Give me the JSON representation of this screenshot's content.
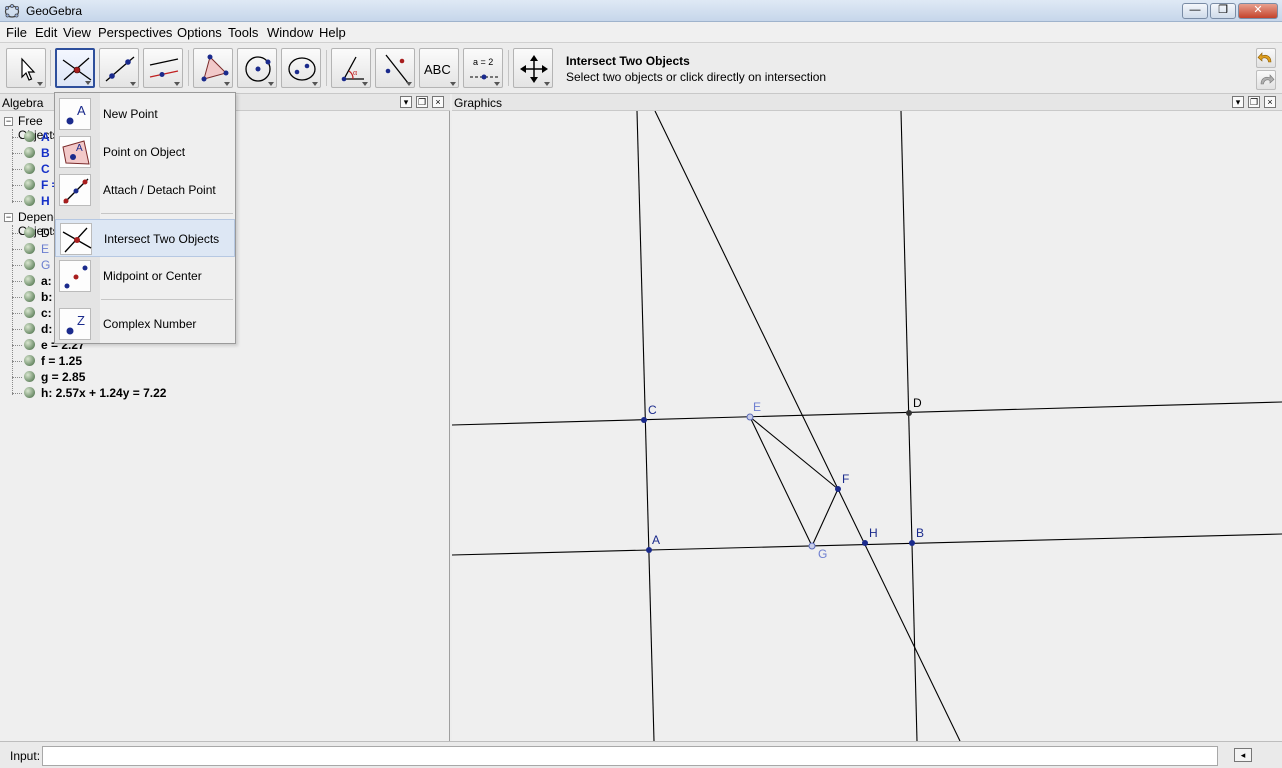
{
  "window": {
    "title": "GeoGebra",
    "minimize": "—",
    "restore": "❐",
    "close": "✕"
  },
  "menu": [
    "File",
    "Edit",
    "View",
    "Perspectives",
    "Options",
    "Tools",
    "Window",
    "Help"
  ],
  "toolbar": {
    "tools": [
      "Move",
      "Intersect Two Objects",
      "Line through Two Points",
      "Perpendicular Line",
      "Polygon",
      "Circle with Center through Point",
      "Ellipse",
      "Angle",
      "Reflect about Line",
      "Insert Text",
      "Slider",
      "Move Graphics View"
    ],
    "text_tool_glyph": "ABC",
    "slider_tool_glyph": "a = 2",
    "active_tool_name": "Intersect Two Objects",
    "active_tool_help": "Select two objects or click directly on intersection"
  },
  "algebra": {
    "title": "Algebra",
    "groups": [
      {
        "label": "Free Objects",
        "collapse": "−",
        "items": [
          {
            "text": "A",
            "style": "free"
          },
          {
            "text": "B",
            "style": "free"
          },
          {
            "text": "C",
            "style": "free"
          },
          {
            "text": "F =",
            "style": "free"
          },
          {
            "text": "H",
            "style": "free"
          }
        ]
      },
      {
        "label": "Dependent Objects",
        "collapse": "−",
        "items": [
          {
            "text": "D",
            "style": "dep"
          },
          {
            "text": "E",
            "style": "light"
          },
          {
            "text": "G",
            "style": "light"
          },
          {
            "text": "a:",
            "style": "dep"
          },
          {
            "text": "b:",
            "style": "dep"
          },
          {
            "text": "c:",
            "style": "dep"
          },
          {
            "text": "d:",
            "style": "dep"
          },
          {
            "text": "e = 2.27",
            "style": "dep"
          },
          {
            "text": "f = 1.25",
            "style": "dep"
          },
          {
            "text": "g = 2.85",
            "style": "dep"
          },
          {
            "text": "h: 2.57x + 1.24y = 7.22",
            "style": "dep"
          }
        ]
      }
    ]
  },
  "graphics": {
    "title": "Graphics",
    "points": {
      "A": "A",
      "B": "B",
      "C": "C",
      "D": "D",
      "E": "E",
      "F": "F",
      "G": "G",
      "H": "H"
    }
  },
  "dropdown": {
    "items": [
      {
        "label": "New Point",
        "icon": "new-point-icon"
      },
      {
        "label": "Point on Object",
        "icon": "point-on-object-icon"
      },
      {
        "label": "Attach / Detach Point",
        "icon": "attach-detach-point-icon"
      },
      {
        "label": "Intersect Two Objects",
        "icon": "intersect-icon"
      },
      {
        "label": "Midpoint or Center",
        "icon": "midpoint-icon"
      },
      {
        "label": "Complex Number",
        "icon": "complex-number-icon"
      }
    ],
    "icon_glyphs": {
      "new_point": "A",
      "point_on_object": "A",
      "complex_number": "Z"
    }
  },
  "input_bar": {
    "label": "Input:",
    "value": "",
    "placeholder": ""
  },
  "colors": {
    "point_blue": "#1a2a8c",
    "point_light": "#6e7fd0",
    "accent_selected": "#2e4f9c"
  }
}
